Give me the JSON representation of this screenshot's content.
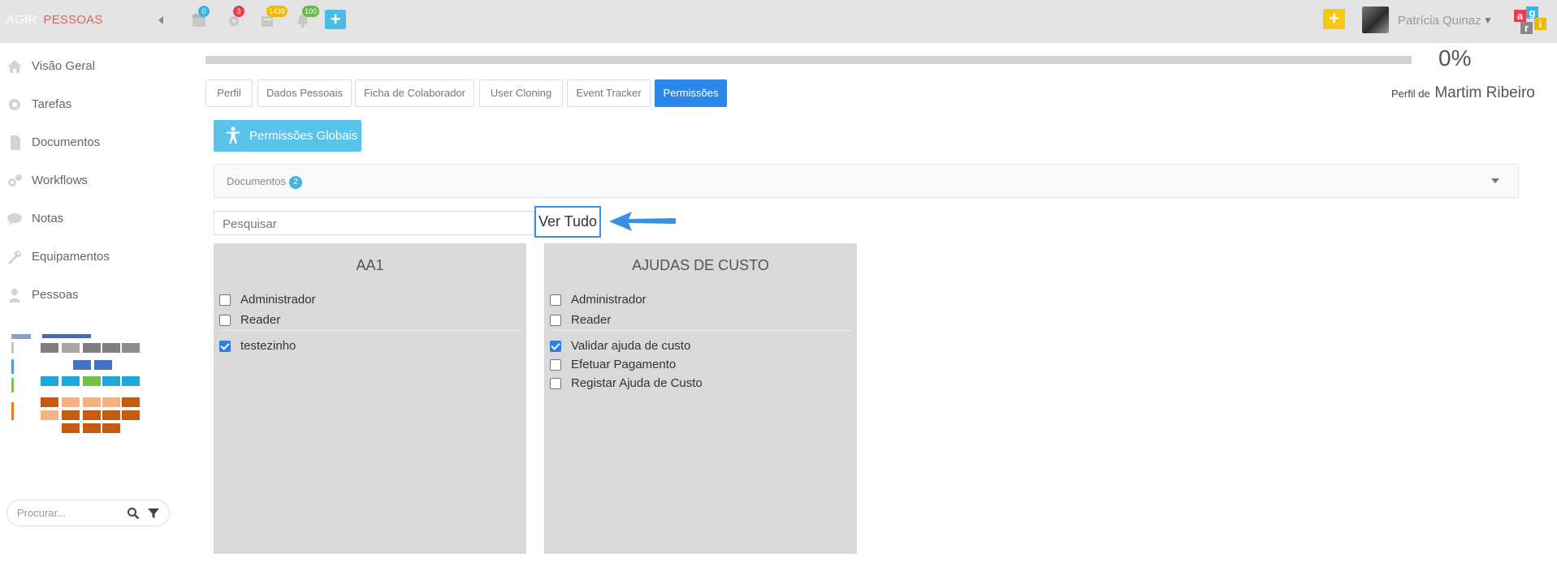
{
  "brand": {
    "part1": "AGIR",
    "part2": "PESSOAS"
  },
  "topbar": {
    "badges": {
      "calendar": "0",
      "settings": "3",
      "inbox": "1439",
      "notifications": "100"
    },
    "user_name": "Patrícia Quinaz",
    "logo_letters": [
      "a",
      "g",
      "r",
      "i"
    ]
  },
  "sidebar": {
    "items": [
      {
        "label": "Visão Geral",
        "icon": "home-icon"
      },
      {
        "label": "Tarefas",
        "icon": "gear-icon"
      },
      {
        "label": "Documentos",
        "icon": "document-icon"
      },
      {
        "label": "Workflows",
        "icon": "gears-icon"
      },
      {
        "label": "Notas",
        "icon": "chat-icon"
      },
      {
        "label": "Equipamentos",
        "icon": "wrench-icon"
      },
      {
        "label": "Pessoas",
        "icon": "user-icon"
      }
    ],
    "search_placeholder": "Procurar..."
  },
  "profile": {
    "progress_percent": 0,
    "progress_label": "0%",
    "perfil_de_label": "Perfil de",
    "person_name": "Martim Ribeiro"
  },
  "tabs": [
    {
      "label": "Perfil",
      "active": false
    },
    {
      "label": "Dados Pessoais",
      "active": false
    },
    {
      "label": "Ficha de Colaborador",
      "active": false
    },
    {
      "label": "User Cloning",
      "active": false
    },
    {
      "label": "Event Tracker",
      "active": false
    },
    {
      "label": "Permissões",
      "active": true
    }
  ],
  "global_button": {
    "label": "Permissões Globais"
  },
  "accordion": {
    "label": "Documentos",
    "count": "2"
  },
  "filter": {
    "placeholder": "Pesquisar",
    "ver_tudo": "Ver Tudo"
  },
  "cards": [
    {
      "title": "AA1",
      "roles": [
        {
          "label": "Administrador",
          "checked": false
        },
        {
          "label": "Reader",
          "checked": false
        }
      ],
      "permissions": [
        {
          "label": "testezinho",
          "checked": true
        }
      ]
    },
    {
      "title": "AJUDAS DE CUSTO",
      "roles": [
        {
          "label": "Administrador",
          "checked": false
        },
        {
          "label": "Reader",
          "checked": false
        }
      ],
      "permissions": [
        {
          "label": "Validar ajuda de custo",
          "checked": true
        },
        {
          "label": "Efetuar Pagamento",
          "checked": false
        },
        {
          "label": "Registar Ajuda de Custo",
          "checked": false
        }
      ]
    }
  ],
  "colors": {
    "accent_blue": "#2b88e8",
    "light_blue": "#59c3ea",
    "brand_red": "#e8605a",
    "card_gray": "#d9d9d9"
  }
}
